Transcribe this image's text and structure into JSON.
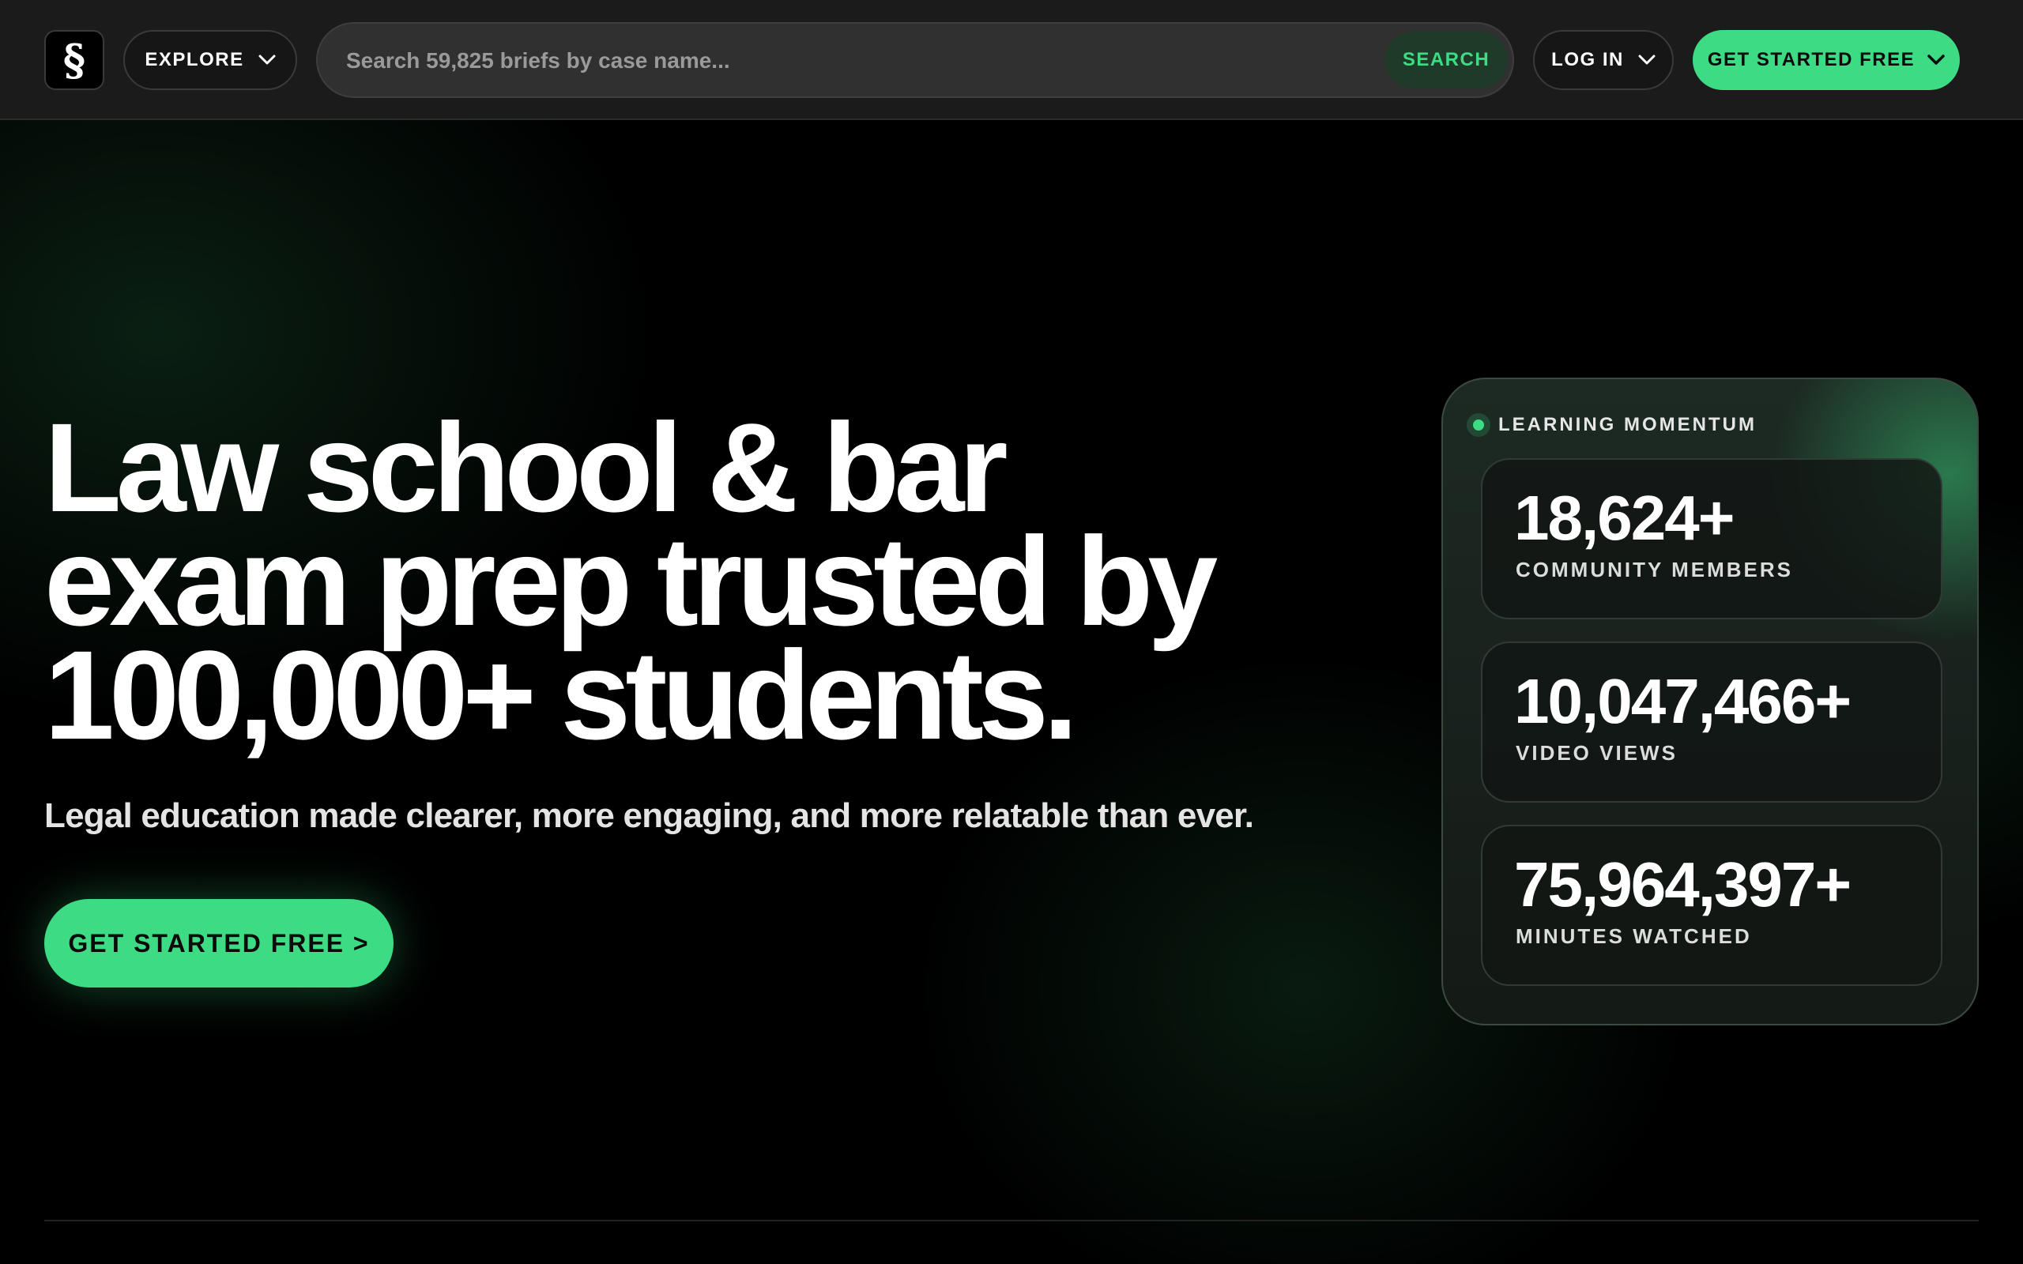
{
  "nav": {
    "logo_glyph": "§",
    "explore_label": "EXPLORE",
    "search_placeholder": "Search 59,825 briefs by case name...",
    "search_button": "SEARCH",
    "login_label": "LOG IN",
    "cta_label": "GET STARTED FREE"
  },
  "hero": {
    "title_lines": [
      "Law school & bar",
      "exam prep trusted by",
      "100,000+ students."
    ],
    "subtitle": "Legal education made clearer, more engaging, and more relatable than ever.",
    "cta_label": "GET STARTED FREE >"
  },
  "stats": {
    "header": "LEARNING MOMENTUM",
    "items": [
      {
        "value": "18,624+",
        "label": "COMMUNITY MEMBERS"
      },
      {
        "value": "10,047,466+",
        "label": "VIDEO VIEWS"
      },
      {
        "value": "75,964,397+",
        "label": "MINUTES WATCHED"
      }
    ]
  },
  "colors": {
    "accent": "#3ddc84",
    "nav_bg": "#1b1b1b",
    "page_bg": "#000000"
  },
  "icons": [
    "section-sign-logo-icon",
    "chevron-down-icon",
    "status-dot-icon"
  ]
}
